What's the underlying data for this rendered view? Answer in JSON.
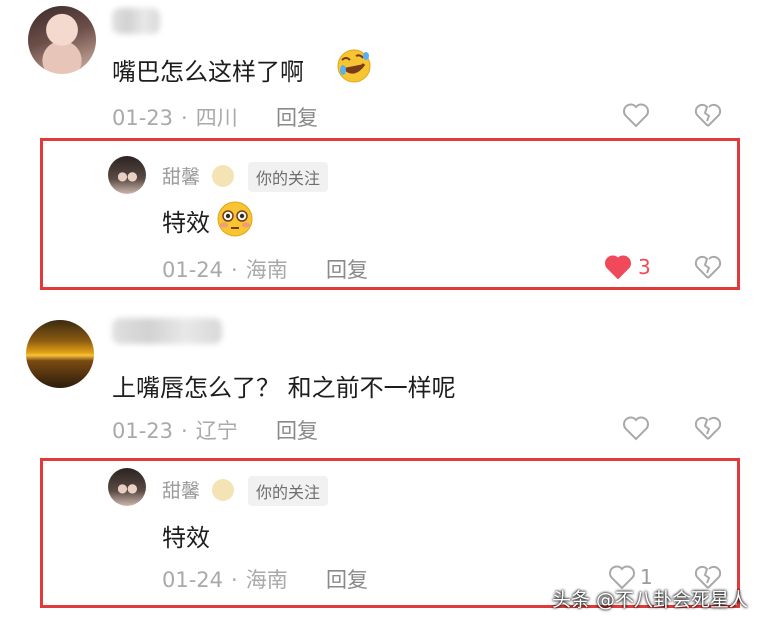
{
  "comments": [
    {
      "text": "嘴巴怎么这样了啊",
      "date": "01-23",
      "location": "四川",
      "reply_label": "回复",
      "emoji": "rolling-laughing-emoji",
      "reply": {
        "username": "甜馨",
        "badge": "你的关注",
        "text": "特效",
        "emoji": "flushed-emoji",
        "date": "01-24",
        "location": "海南",
        "reply_label": "回复",
        "like_count": "3",
        "liked": true
      }
    },
    {
      "text": "上嘴唇怎么了？ 和之前不一样呢",
      "date": "01-23",
      "location": "辽宁",
      "reply_label": "回复",
      "reply": {
        "username": "甜馨",
        "badge": "你的关注",
        "text": "特效",
        "date": "01-24",
        "location": "海南",
        "reply_label": "回复",
        "like_count": "1",
        "liked": false
      }
    }
  ],
  "watermark": "头条 @不八卦会死星人",
  "colors": {
    "highlight_border": "#e03a3a",
    "liked_heart": "#f04a5a"
  }
}
